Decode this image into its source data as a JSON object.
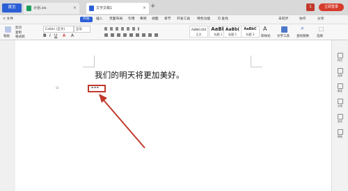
{
  "tabs": {
    "home": "首页",
    "file1": "计划.xls",
    "file2": "文字文稿1",
    "new_tab": "+",
    "window_count": "1",
    "login": "立即登录"
  },
  "menu": {
    "file": "≡ 文件",
    "start": "开始",
    "items": [
      "插入",
      "页面布局",
      "引用",
      "审阅",
      "视图",
      "章节",
      "开发工具",
      "特色功能"
    ],
    "search": "Q 查找",
    "sync": "未同步",
    "collab": "协作",
    "share": "分享"
  },
  "ribbon": {
    "paste": "粘贴",
    "cut": "剪切",
    "copy": "复制",
    "format_painter": "格式刷",
    "font_name": "Calibri (正文)",
    "font_size": "五号",
    "styles": [
      {
        "sample": "AaBbCcDd",
        "name": "正文"
      },
      {
        "sample": "AaBb",
        "name": "标题 1"
      },
      {
        "sample": "AaBb(",
        "name": "标题 2"
      },
      {
        "sample": "AaBbC",
        "name": "标题 3"
      }
    ],
    "new_style": "新样式",
    "text_tools": "文字工具",
    "find_replace": "查找替换",
    "select": "选择"
  },
  "document": {
    "line1": "我们的明天将更加美好。",
    "line2": "---"
  },
  "right_panel": [
    "样式",
    "选择",
    "属性",
    "分享",
    "发布",
    "帮助"
  ],
  "colors": {
    "accent": "#2c5fd6",
    "annotation": "#c0392b",
    "login": "#d63b2b"
  }
}
